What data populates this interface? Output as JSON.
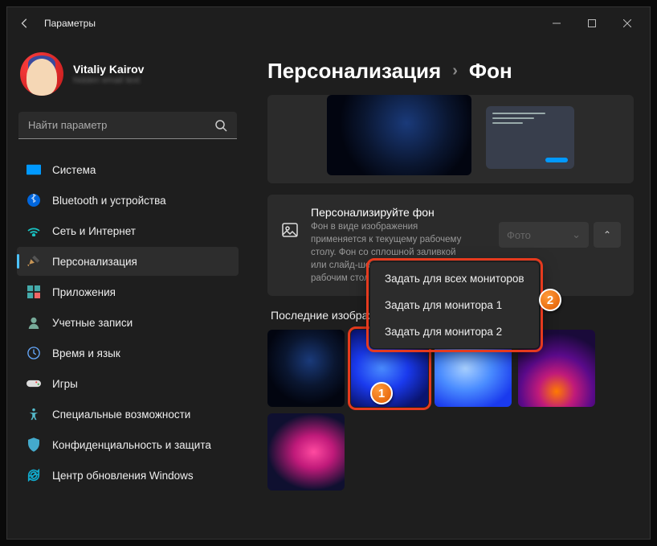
{
  "window": {
    "title": "Параметры"
  },
  "profile": {
    "name": "Vitaliy Kairov",
    "email": "hidden email text"
  },
  "search": {
    "placeholder": "Найти параметр"
  },
  "sidebar": {
    "items": [
      {
        "label": "Система",
        "icon": "system"
      },
      {
        "label": "Bluetooth и устройства",
        "icon": "bluetooth"
      },
      {
        "label": "Сеть и Интернет",
        "icon": "network"
      },
      {
        "label": "Персонализация",
        "icon": "personalization",
        "selected": true
      },
      {
        "label": "Приложения",
        "icon": "apps"
      },
      {
        "label": "Учетные записи",
        "icon": "accounts"
      },
      {
        "label": "Время и язык",
        "icon": "time"
      },
      {
        "label": "Игры",
        "icon": "gaming"
      },
      {
        "label": "Специальные возможности",
        "icon": "accessibility"
      },
      {
        "label": "Конфиденциальность и защита",
        "icon": "privacy"
      },
      {
        "label": "Центр обновления Windows",
        "icon": "update"
      }
    ]
  },
  "breadcrumb": {
    "parent": "Персонализация",
    "current": "Фон"
  },
  "background_setting": {
    "title": "Персонализируйте фон",
    "desc": "Фон в виде изображения применяется к текущему рабочему столу. Фон со сплошной заливкой или слайд-шоу применяется ко всем рабочим столам.",
    "dropdown_value": "Фото"
  },
  "recent": {
    "title": "Последние изображения"
  },
  "context_menu": {
    "items": [
      "Задать для всех мониторов",
      "Задать для монитора 1",
      "Задать для монитора 2"
    ]
  },
  "callouts": {
    "one": "1",
    "two": "2"
  }
}
